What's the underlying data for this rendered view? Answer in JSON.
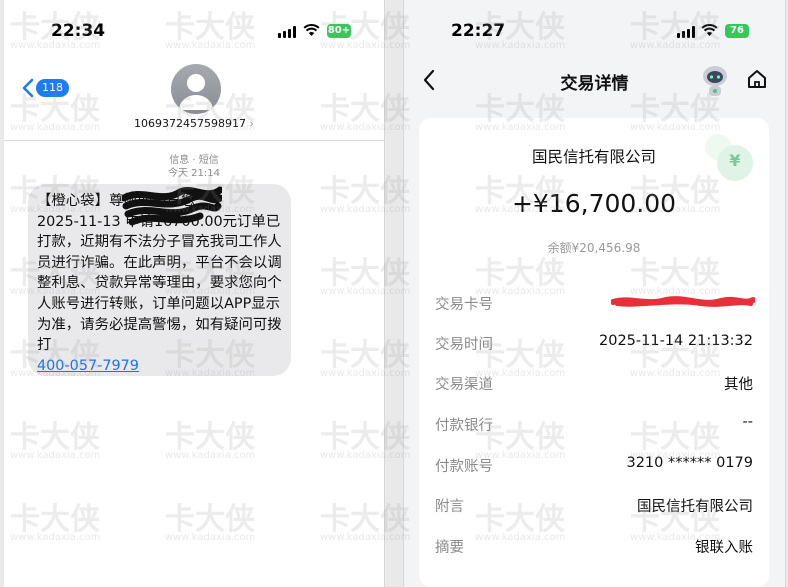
{
  "left": {
    "status": {
      "time": "22:34",
      "battery": "80+"
    },
    "header": {
      "back_badge": "118",
      "sender": "1069372457598917"
    },
    "meta": {
      "line1": "信息 · 短信",
      "line2": "今天 21:14"
    },
    "message": {
      "text": "【橙心袋】尊敬的用户您\n2025-11-13 申请16700.00元订单已打款，近期有不法分子冒充我司工作人员进行诈骗。在此声明，平台不会以调整利息、贷款异常等理由，要求您向个人账号进行转账，订单问题以APP显示为准，请务必提高警惕，如有疑问可拨打",
      "phone": "400-057-7979"
    }
  },
  "right": {
    "status": {
      "time": "22:27",
      "battery": "76"
    },
    "header": {
      "title": "交易详情"
    },
    "card": {
      "payee": "国民信托有限公司",
      "amount": "+¥16,700.00",
      "balance": "余额¥20,456.98",
      "rows": [
        {
          "label": "交易卡号",
          "value": ""
        },
        {
          "label": "交易时间",
          "value": "2025-11-14 21:13:32"
        },
        {
          "label": "交易渠道",
          "value": "其他"
        },
        {
          "label": "付款银行",
          "value": "--"
        },
        {
          "label": "付款账号",
          "value": "3210 ****** 0179"
        },
        {
          "label": "附言",
          "value": "国民信托有限公司"
        },
        {
          "label": "摘要",
          "value": "银联入账"
        }
      ]
    }
  },
  "watermark": {
    "brand": "卡大侠",
    "url": "www.kadaxia.com"
  },
  "colors": {
    "link": "#1a73e8",
    "badge": "#1c7cf2",
    "battery": "#34c759",
    "redaction": "#e8303a"
  }
}
